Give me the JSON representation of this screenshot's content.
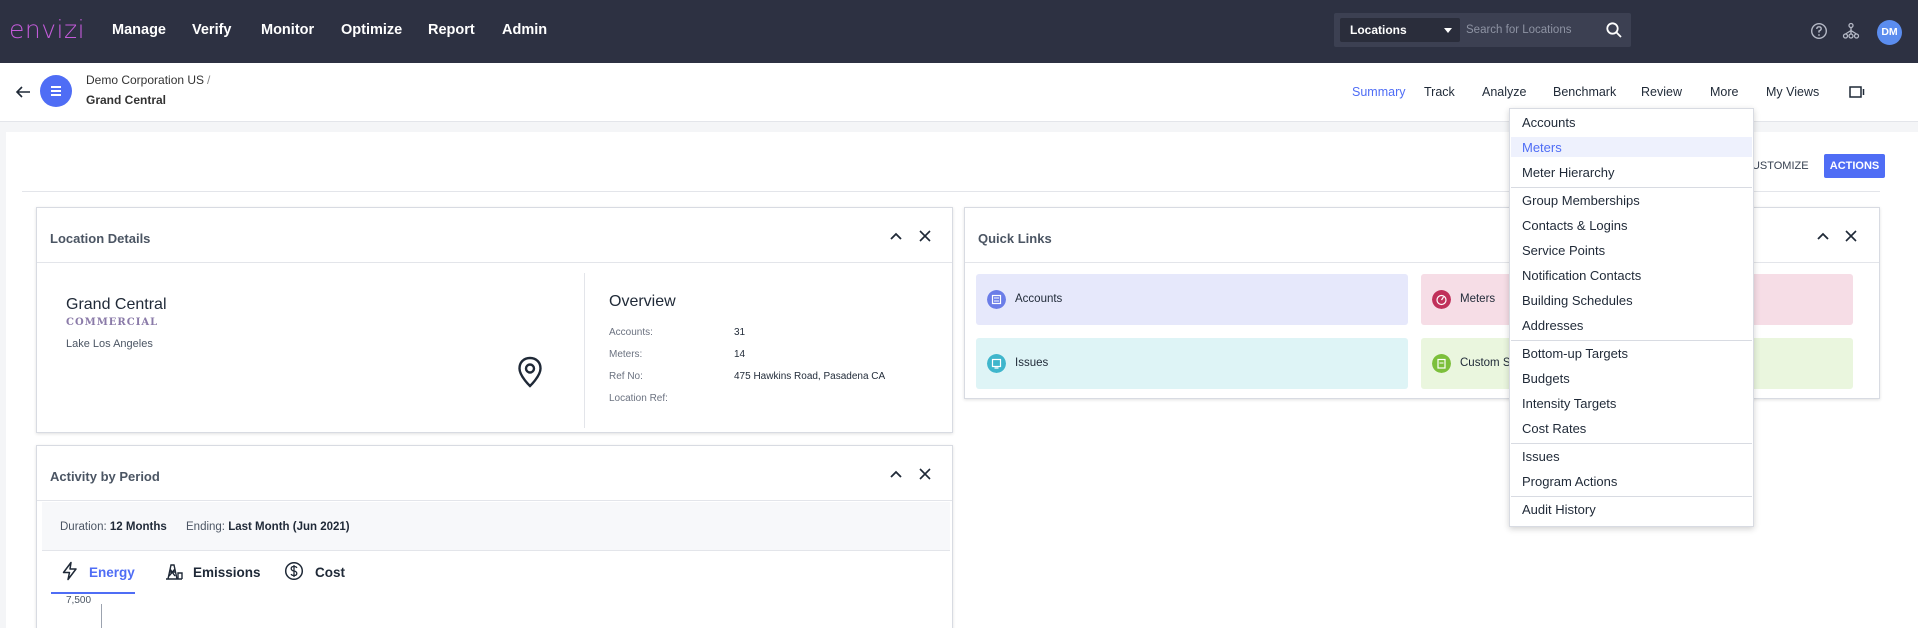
{
  "app": {
    "logo": "envizi"
  },
  "nav": {
    "items": [
      "Manage",
      "Verify",
      "Monitor",
      "Optimize",
      "Report",
      "Admin"
    ]
  },
  "search": {
    "scope": "Locations",
    "placeholder": "Search for Locations"
  },
  "user": {
    "initials": "DM"
  },
  "breadcrumb": {
    "parent": "Demo Corporation US",
    "separator": "/",
    "current": "Grand Central"
  },
  "tabs": [
    "Summary",
    "Track",
    "Analyze",
    "Benchmark",
    "Review",
    "More",
    "My Views"
  ],
  "toolbar": {
    "customize": "CUSTOMIZE",
    "actions": "ACTIONS"
  },
  "location_details": {
    "title": "Location Details",
    "name": "Grand Central",
    "type": "COMMERCIAL",
    "city": "Lake Los Angeles",
    "overview": {
      "title": "Overview",
      "rows": [
        {
          "label": "Accounts:",
          "value": "31"
        },
        {
          "label": "Meters:",
          "value": "14"
        },
        {
          "label": "Ref No:",
          "value": "475 Hawkins Road, Pasadena CA"
        },
        {
          "label": "Location Ref:",
          "value": ""
        }
      ]
    }
  },
  "quick_links": {
    "title": "Quick Links",
    "items": [
      {
        "label": "Accounts",
        "bg": "#e6e8fb",
        "icon_color": "#6b7de8"
      },
      {
        "label": "Meters",
        "bg": "#f6dde6",
        "icon_color": "#c0305a"
      },
      {
        "label": "Issues",
        "bg": "#def4f6",
        "icon_color": "#3fb6cc"
      },
      {
        "label": "Custom S",
        "bg": "#eaf6de",
        "icon_color": "#7cbf3b"
      }
    ]
  },
  "activity": {
    "title": "Activity by Period",
    "duration_label": "Duration:",
    "duration_value": "12 Months",
    "ending_label": "Ending:",
    "ending_value": "Last Month (Jun 2021)",
    "tabs": [
      "Energy",
      "Emissions",
      "Cost"
    ],
    "y_tick": "7,500"
  },
  "more_menu": {
    "items": [
      "Accounts",
      "Meters",
      "Meter Hierarchy",
      "Group Memberships",
      "Contacts & Logins",
      "Service Points",
      "Notification Contacts",
      "Building Schedules",
      "Addresses",
      "Bottom-up Targets",
      "Budgets",
      "Intensity Targets",
      "Cost Rates",
      "Issues",
      "Program Actions",
      "Audit History"
    ],
    "highlighted": "Meters"
  },
  "colors": {
    "nav_bg": "#2d3142",
    "accent": "#4f6df5",
    "logo": "#c35bd9"
  }
}
